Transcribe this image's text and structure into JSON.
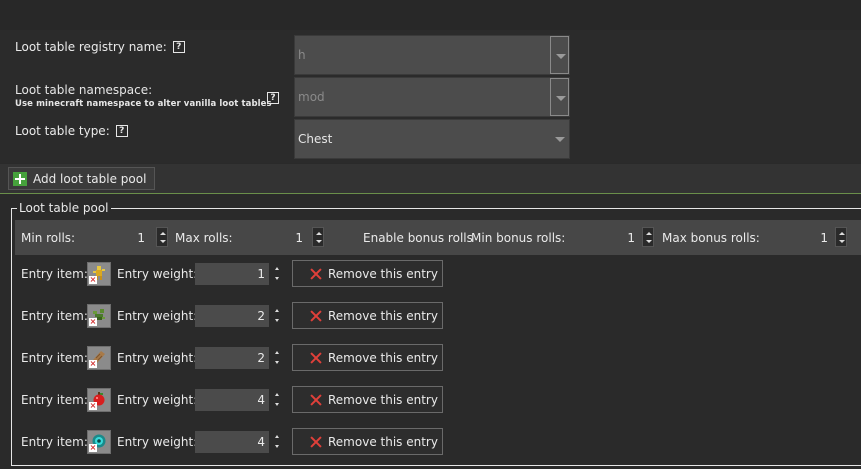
{
  "form": {
    "registry_label": "Loot table registry name:",
    "registry_value": "h",
    "namespace_label": "Loot table namespace:",
    "namespace_sub": "Use minecraft namespace to alter vanilla loot tables",
    "namespace_value": "mod",
    "type_label": "Loot table type:",
    "type_value": "Chest",
    "help_glyph": "?"
  },
  "toolbar": {
    "add_pool_label": "Add loot table pool"
  },
  "pool": {
    "title": "Loot table pool",
    "min_rolls_label": "Min rolls:",
    "min_rolls_value": "1",
    "max_rolls_label": "Max rolls:",
    "max_rolls_value": "1",
    "enable_bonus_label": "Enable bonus rolls",
    "min_bonus_label": "Min bonus rolls:",
    "min_bonus_value": "1",
    "max_bonus_label": "Max bonus rolls:",
    "max_bonus_value": "1",
    "entries": [
      {
        "item_label": "Entry item:",
        "item_icon": "golden-figure-icon",
        "weight_label": "Entry weight:",
        "weight": "1",
        "remove_label": "Remove this entry"
      },
      {
        "item_label": "Entry item:",
        "item_icon": "green-plant-icon",
        "weight_label": "Entry weight:",
        "weight": "2",
        "remove_label": "Remove this entry"
      },
      {
        "item_label": "Entry item:",
        "item_icon": "bread-loaf-icon",
        "weight_label": "Entry weight:",
        "weight": "2",
        "remove_label": "Remove this entry"
      },
      {
        "item_label": "Entry item:",
        "item_icon": "red-apple-icon",
        "weight_label": "Entry weight:",
        "weight": "4",
        "remove_label": "Remove this entry"
      },
      {
        "item_label": "Entry item:",
        "item_icon": "cyan-orb-icon",
        "weight_label": "Entry weight:",
        "weight": "4",
        "remove_label": "Remove this entry"
      }
    ]
  },
  "colors": {
    "accent_green": "#46a23c",
    "remove_red": "#e0403a"
  }
}
